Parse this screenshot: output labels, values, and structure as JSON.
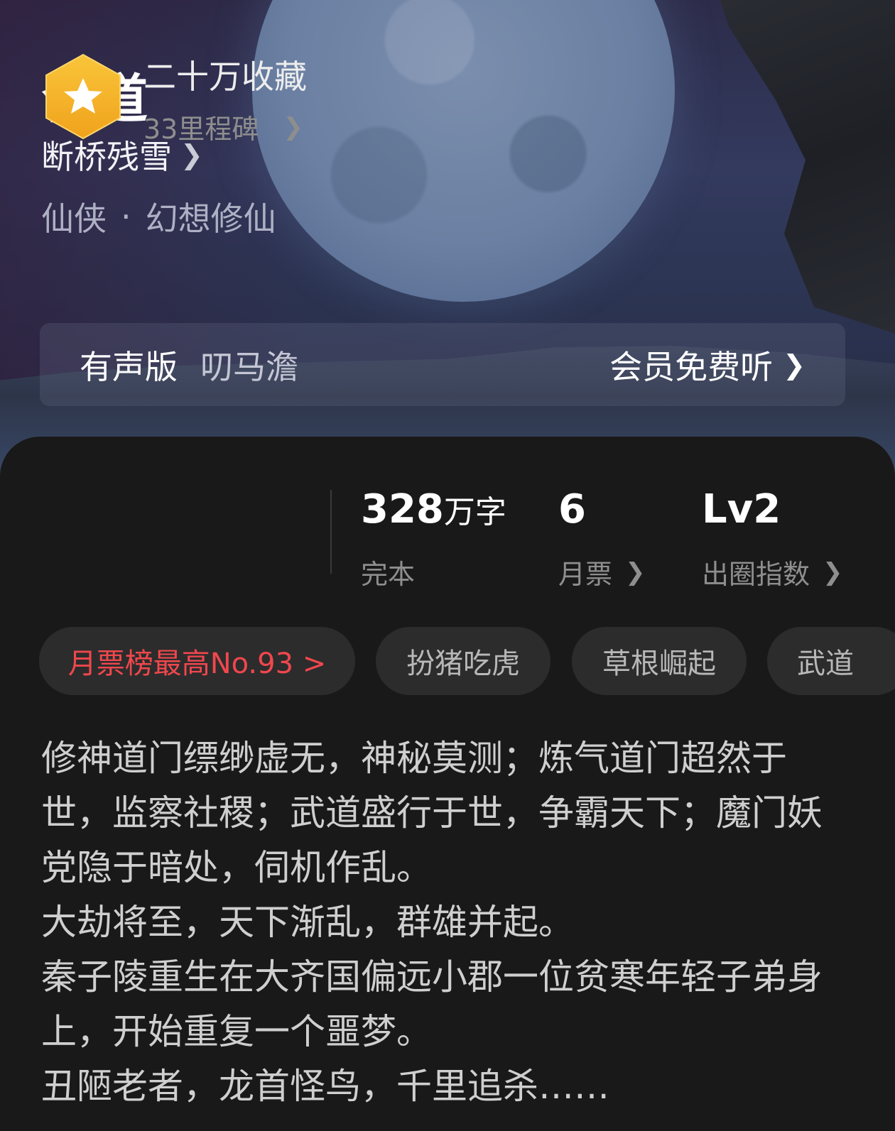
{
  "book": {
    "title": "合道",
    "author": "断桥残雪",
    "category": "仙侠",
    "subcategory": "幻想修仙"
  },
  "audio": {
    "label": "有声版",
    "narrator": "叨马澹",
    "action": "会员免费听"
  },
  "stats": {
    "favorites": "二十万收藏",
    "milestones": "33里程碑",
    "word_count": "328",
    "word_unit": "万字",
    "status": "完本",
    "monthly_tickets": "6",
    "monthly_tickets_label": "月票",
    "level": "Lv2",
    "level_label": "出圈指数"
  },
  "tags": {
    "rank": "月票榜最高No.93 >",
    "items": [
      "扮猪吃虎",
      "草根崛起",
      "武道"
    ]
  },
  "synopsis": [
    "修神道门缥缈虚无，神秘莫测；炼气道门超然于世，监察社稷；武道盛行于世，争霸天下；魔门妖党隐于暗处，伺机作乱。",
    "大劫将至，天下渐乱，群雄并起。",
    "秦子陵重生在大齐国偏远小郡一位贫寒年轻子弟身上，开始重复一个噩梦。",
    "丑陋老者，龙首怪鸟，千里追杀……"
  ],
  "colors": {
    "background": "#191919",
    "accent_red": "#f0474d",
    "badge_gold": "#f5b52a"
  }
}
